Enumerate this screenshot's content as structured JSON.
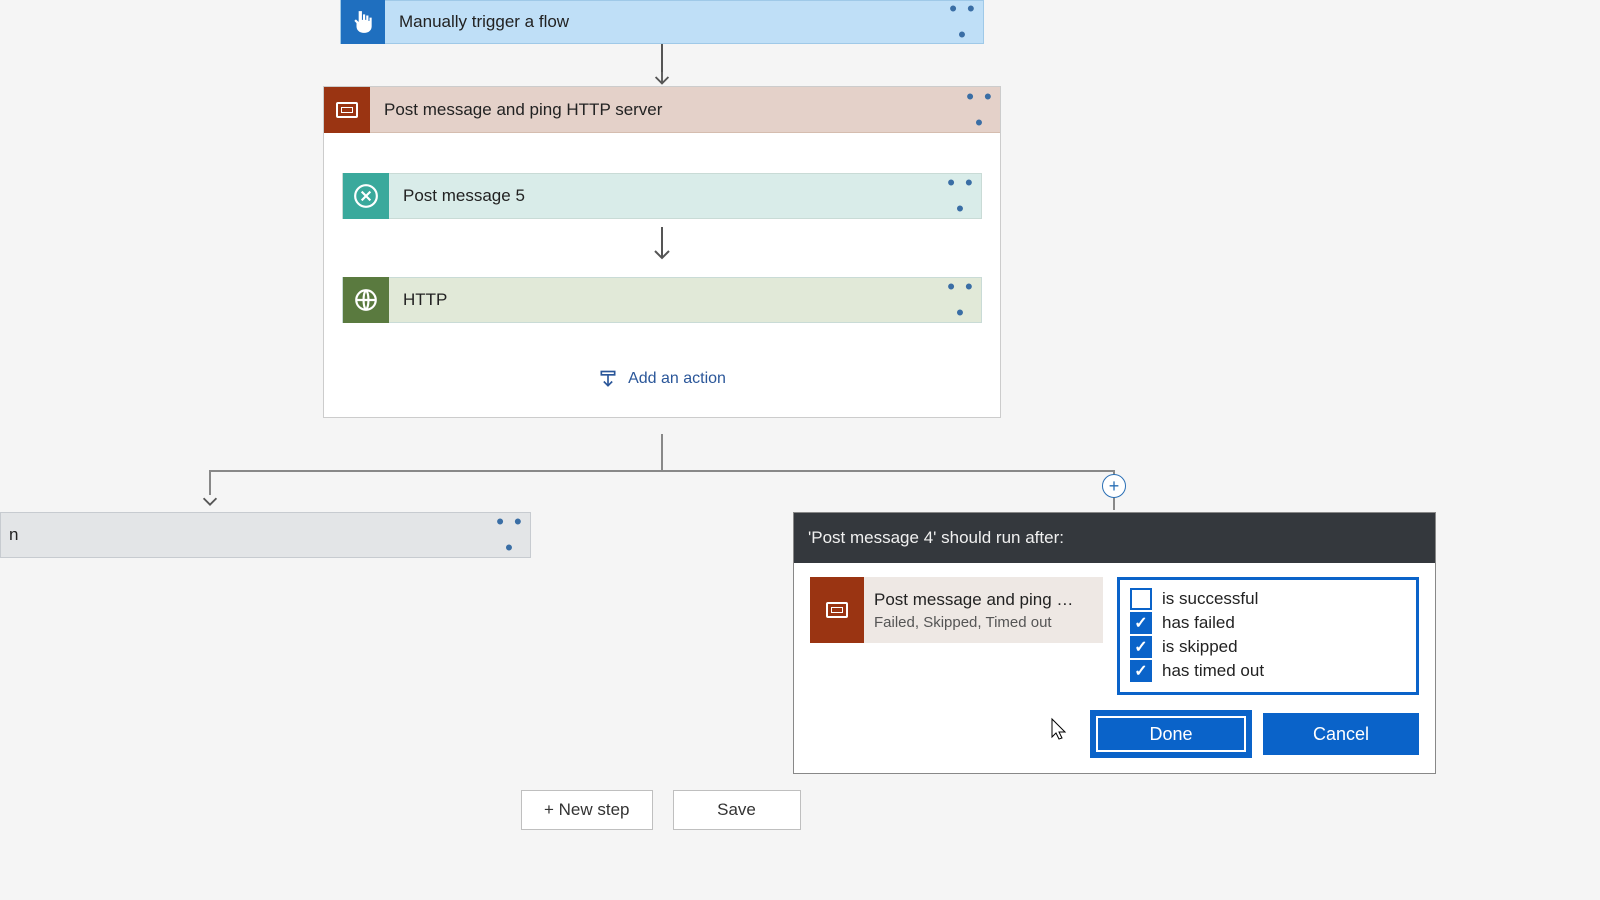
{
  "trigger": {
    "title": "Manually trigger a flow"
  },
  "scope": {
    "title": "Post message and ping HTTP server",
    "action1": "Post message 5",
    "action2": "HTTP",
    "add_action": "Add an action"
  },
  "left_branch": {
    "title_suffix": "n"
  },
  "dialog": {
    "header": "'Post message 4' should run after:",
    "dep_title": "Post message and ping HTTP s...",
    "dep_status": "Failed, Skipped, Timed out",
    "checks": {
      "successful": {
        "label": "is successful",
        "checked": false
      },
      "failed": {
        "label": "has failed",
        "checked": true
      },
      "skipped": {
        "label": "is skipped",
        "checked": true
      },
      "timedout": {
        "label": "has timed out",
        "checked": true
      }
    },
    "done": "Done",
    "cancel": "Cancel"
  },
  "footer": {
    "new_step": "+ New step",
    "save": "Save"
  },
  "glyphs": {
    "ellipsis": "• • •",
    "plus": "+"
  }
}
